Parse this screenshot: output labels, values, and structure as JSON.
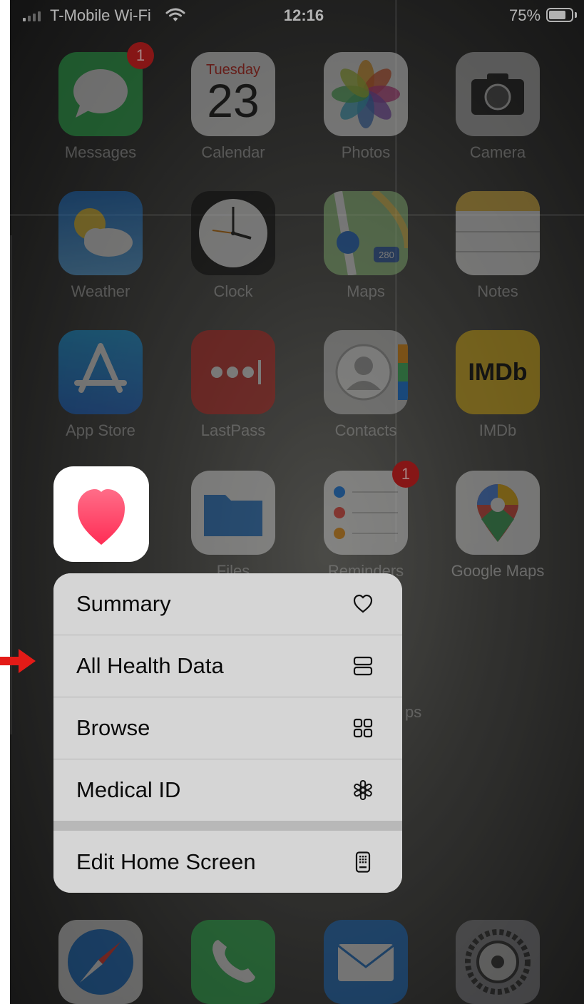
{
  "status_bar": {
    "carrier": "T-Mobile Wi-Fi",
    "time": "12:16",
    "battery_percent": "75%",
    "battery_level": 0.75
  },
  "apps": [
    {
      "name": "Messages",
      "badge": "1"
    },
    {
      "name": "Calendar",
      "weekday": "Tuesday",
      "day": "23"
    },
    {
      "name": "Photos"
    },
    {
      "name": "Camera"
    },
    {
      "name": "Weather"
    },
    {
      "name": "Clock"
    },
    {
      "name": "Maps",
      "highway": "280"
    },
    {
      "name": "Notes"
    },
    {
      "name": "App Store"
    },
    {
      "name": "LastPass"
    },
    {
      "name": "Contacts"
    },
    {
      "name": "IMDb",
      "logo": "IMDb"
    },
    {
      "name": "Files"
    },
    {
      "name": "Reminders",
      "badge": "1"
    },
    {
      "name": "Google Maps"
    },
    {
      "name": "ps"
    }
  ],
  "dock": [
    {
      "name": "Safari",
      "icon": "compass-icon"
    },
    {
      "name": "Phone",
      "icon": "phone-icon"
    },
    {
      "name": "Mail",
      "icon": "envelope-icon"
    },
    {
      "name": "Settings",
      "icon": "gear-icon"
    }
  ],
  "context_menu": {
    "items": [
      {
        "label": "Summary",
        "icon": "heart-outline-icon"
      },
      {
        "label": "All Health Data",
        "icon": "stacked-rectangles-icon"
      },
      {
        "label": "Browse",
        "icon": "grid-icon"
      },
      {
        "label": "Medical ID",
        "icon": "asterisk-icon"
      },
      {
        "label": "Edit Home Screen",
        "icon": "phone-apps-icon"
      }
    ]
  },
  "colors": {
    "heart": "#ff3b5c",
    "annotation_arrow": "#e41b17",
    "menu_background": "#d5d5d5"
  }
}
